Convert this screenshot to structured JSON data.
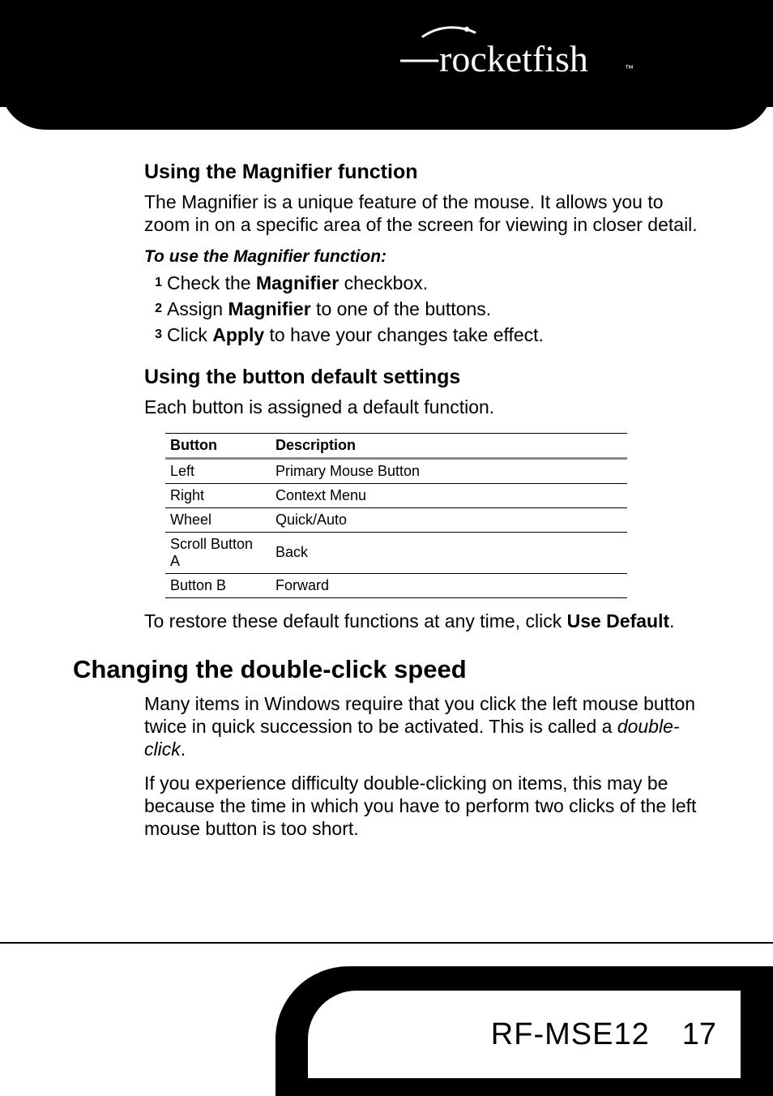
{
  "logo_text": "rocketfish",
  "sections": {
    "magnifier": {
      "heading": "Using the Magnifier function",
      "intro": "The Magnifier is a unique feature of the mouse. It allows you to zoom in on a specific area of the screen for viewing in closer detail.",
      "procedure_label": "To use the Magnifier function:",
      "s1_num": "1",
      "s1_a": "Check the ",
      "s1_b": "Magnifier",
      "s1_c": " checkbox.",
      "s2_num": "2",
      "s2_a": "Assign ",
      "s2_b": "Magnifier",
      "s2_c": " to one of the buttons.",
      "s3_num": "3",
      "s3_a": "Click ",
      "s3_b": "Apply",
      "s3_c": " to have your changes take effect."
    },
    "defaults": {
      "heading": "Using the button default settings",
      "intro": "Each button is assigned a default function.",
      "th_button": "Button",
      "th_desc": "Description",
      "rows": {
        "r0_b": "Left",
        "r0_d": "Primary Mouse Button",
        "r1_b": "Right",
        "r1_d": "Context Menu",
        "r2_b": "Wheel",
        "r2_d": "Quick/Auto",
        "r3_b": "Scroll Button A",
        "r3_d": "Back",
        "r4_b": "Button B",
        "r4_d": "Forward"
      },
      "after_a": "To restore these default functions at any time, click ",
      "after_b": "Use Default",
      "after_c": "."
    },
    "doubleclick": {
      "heading": "Changing the double-click speed",
      "p1_a": "Many items in Windows require that you click the left mouse button twice in quick succession to be activated. This is called a ",
      "p1_b": "double-click",
      "p1_c": ".",
      "p2": "If you experience difficulty double-clicking on items, this may be because the time in which you have to perform two clicks of the left mouse button is too short."
    }
  },
  "footer": {
    "model": "RF-MSE12",
    "page": "17"
  }
}
